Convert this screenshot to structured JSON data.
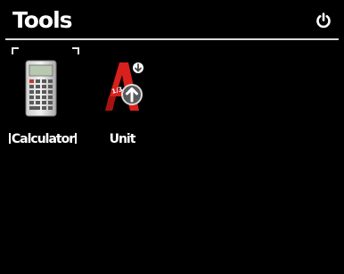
{
  "header": {
    "title": "Tools",
    "power_icon": "power-icon"
  },
  "apps": [
    {
      "label": "Calculator",
      "icon": "calculator-icon",
      "selected": true
    },
    {
      "label": "Unit",
      "icon": "unit-converter-icon",
      "selected": false
    }
  ],
  "colors": {
    "background": "#000000",
    "text": "#ffffff",
    "divider": "#d8d8d8",
    "unit_icon_red": "#d8201c"
  }
}
